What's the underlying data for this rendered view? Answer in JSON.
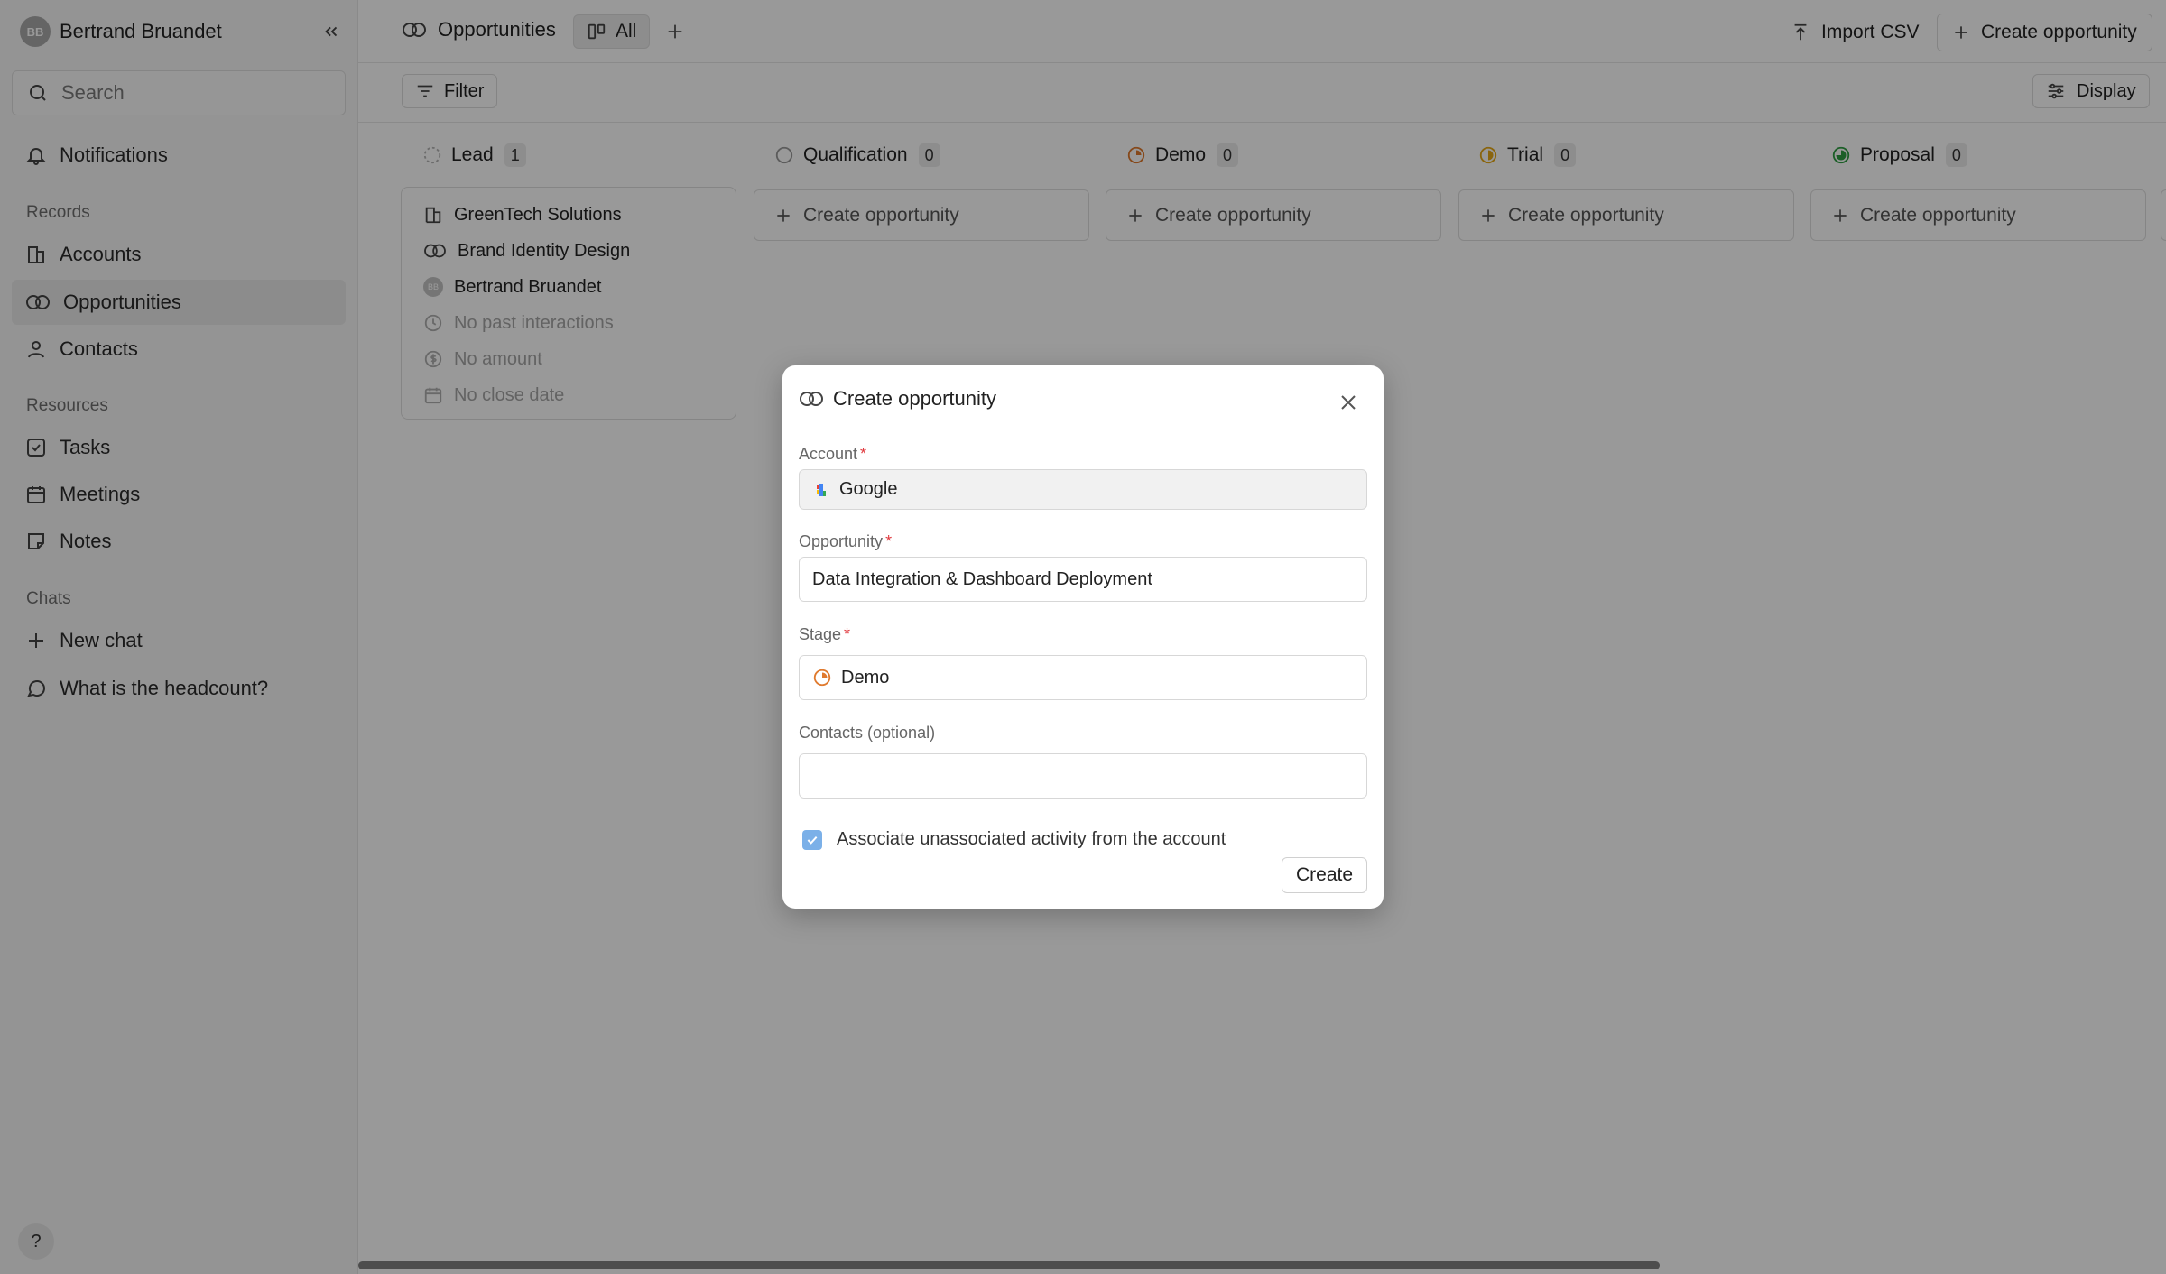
{
  "sidebar": {
    "user": {
      "initials": "BB",
      "name": "Bertrand Bruandet"
    },
    "search_placeholder": "Search",
    "notifications": "Notifications",
    "sections": {
      "records": "Records",
      "resources": "Resources",
      "chats": "Chats"
    },
    "records": [
      "Accounts",
      "Opportunities",
      "Contacts"
    ],
    "resources": [
      "Tasks",
      "Meetings",
      "Notes"
    ],
    "chats": [
      "New chat",
      "What is the headcount?"
    ],
    "active_item": "Opportunities",
    "help": "?"
  },
  "header": {
    "title": "Opportunities",
    "view_tab": "All",
    "import_label": "Import CSV",
    "create_label": "Create opportunity"
  },
  "toolbar": {
    "filter_label": "Filter",
    "display_label": "Display"
  },
  "board": {
    "columns": [
      {
        "name": "Lead",
        "count": "1",
        "color": "#b5b5b5"
      },
      {
        "name": "Qualification",
        "count": "0",
        "color": "#9a9a9a"
      },
      {
        "name": "Demo",
        "count": "0",
        "color": "#e07a2e"
      },
      {
        "name": "Trial",
        "count": "0",
        "color": "#e6a817"
      },
      {
        "name": "Proposal",
        "count": "0",
        "color": "#2f9e44"
      }
    ],
    "create_card_label": "Create opportunity",
    "card": {
      "account": "GreenTech Solutions",
      "opportunity": "Brand Identity Design",
      "owner": "Bertrand Bruandet",
      "owner_initials": "BB",
      "interactions": "No past interactions",
      "amount": "No amount",
      "close_date": "No close date"
    }
  },
  "modal": {
    "title": "Create opportunity",
    "account_label": "Account",
    "account_value": "Google",
    "opportunity_label": "Opportunity",
    "opportunity_value": "Data Integration & Dashboard Deployment",
    "stage_label": "Stage",
    "stage_value": "Demo",
    "contacts_label": "Contacts (optional)",
    "contacts_value": "",
    "required_mark": "*",
    "associate_label": "Associate unassociated activity from the account",
    "associate_checked": true,
    "create_label": "Create"
  },
  "colors": {
    "required": "#e0393e",
    "checkbox": "#7bb0e8",
    "demo_stage": "#e07a2e"
  }
}
